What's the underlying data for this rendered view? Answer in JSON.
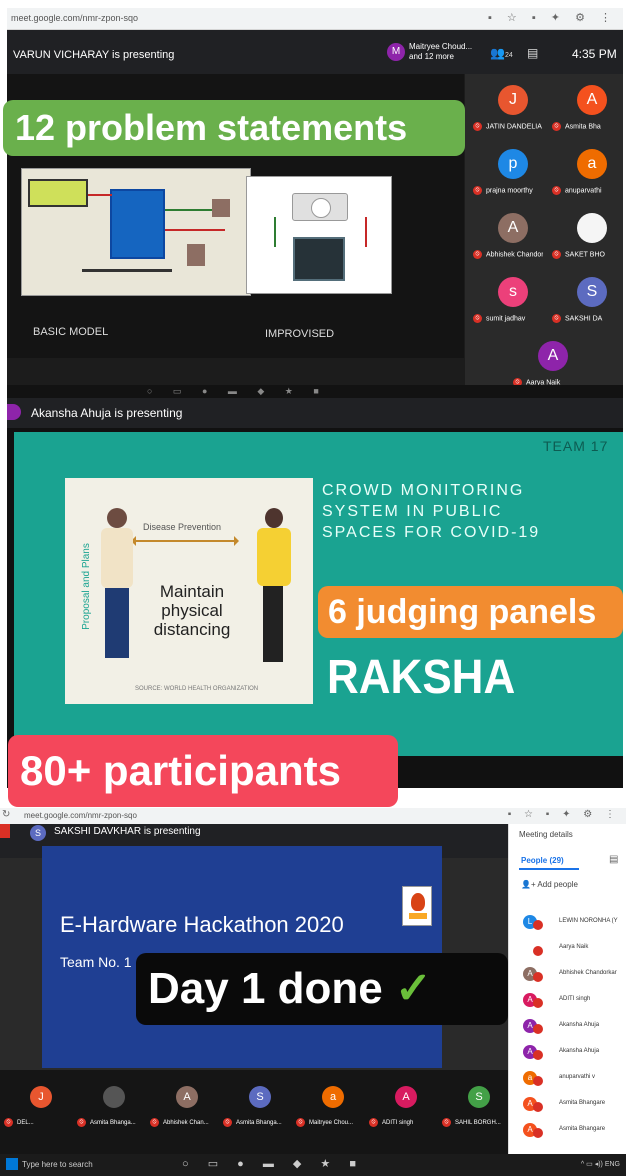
{
  "panel1": {
    "url": "meet.google.com/nmr-zpon-sqo",
    "presenting": "VARUN VICHARAY is presenting",
    "host_initial": "M",
    "host_name": "Maitryee Choud... and 12 more",
    "people_count": "24",
    "time": "4:35 PM",
    "banner": "12 problem statements",
    "caption_basic": "BASIC MODEL",
    "caption_improvised": "IMPROVISED",
    "tiles": [
      {
        "initial": "J",
        "name": "JATIN DANDELIA",
        "color": "#e8562f"
      },
      {
        "initial": "A",
        "name": "Asmita Bha",
        "color": "#f4511e"
      },
      {
        "initial": "p",
        "name": "prajna moorthy",
        "color": "#1e88e5"
      },
      {
        "initial": "a",
        "name": "anuparvathi",
        "color": "#ef6c00"
      },
      {
        "initial": "A",
        "name": "Abhishek Chandorkar",
        "color": "#8d6e63"
      },
      {
        "initial": "",
        "name": "SAKET BHO",
        "color": "#f5f5f5"
      },
      {
        "initial": "s",
        "name": "sumit jadhav",
        "color": "#ec407a"
      },
      {
        "initial": "S",
        "name": "SAKSHI DA",
        "color": "#5c6bc0"
      },
      {
        "initial": "A",
        "name": "Aarya Naik",
        "color": "#8e24aa"
      }
    ]
  },
  "panel2": {
    "presenting": "Akansha Ahuja is presenting",
    "team": "TEAM 17",
    "title_lines": [
      "CROWD MONITORING",
      "SYSTEM IN PUBLIC",
      "SPACES FOR COVID-19"
    ],
    "poster_vertical": "Proposal and Plans",
    "poster_top": "Disease Prevention",
    "poster_main": "Maintain physical distancing",
    "poster_source": "SOURCE: WORLD HEALTH ORGANIZATION",
    "banner": "6 judging panels",
    "project": "RAKSHA",
    "participants_banner": "80+ participants"
  },
  "panel3": {
    "url": "meet.google.com/nmr-zpon-sqo",
    "presenter_initial": "S",
    "presenting": "SAKSHI DAVKHAR is presenting",
    "hackathon": "E-Hardware Hackathon 2020",
    "team_no": "Team No. 1",
    "banner": "Day 1 done",
    "check": "✓",
    "meeting_details": "Meeting details",
    "people_tab": "People (29)",
    "add_people": "Add people",
    "people": [
      {
        "initial": "L",
        "name": "LEWIN NORONHA (Y",
        "color": "#1e88e5"
      },
      {
        "initial": "",
        "name": "Aarya Naik",
        "color": "#ffffff"
      },
      {
        "initial": "A",
        "name": "Abhishek Chandorkar",
        "color": "#8d6e63"
      },
      {
        "initial": "A",
        "name": "ADITI singh",
        "color": "#d81b60"
      },
      {
        "initial": "A",
        "name": "Akansha Ahuja",
        "color": "#8e24aa"
      },
      {
        "initial": "A",
        "name": "Akansha Ahuja",
        "color": "#8e24aa"
      },
      {
        "initial": "a",
        "name": "anuparvathi v",
        "color": "#ef6c00"
      },
      {
        "initial": "A",
        "name": "Asmita Bhangare",
        "color": "#f4511e"
      },
      {
        "initial": "A",
        "name": "Asmita Bhangare",
        "color": "#f4511e"
      }
    ],
    "bottom_tiles": [
      {
        "initial": "J",
        "name": "DEL...",
        "color": "#e8562f"
      },
      {
        "initial": "",
        "name": "Asmita Bhanga...",
        "color": "#555555"
      },
      {
        "initial": "A",
        "name": "Abhishek Chan...",
        "color": "#8d6e63"
      },
      {
        "initial": "S",
        "name": "Asmita Bhanga...",
        "color": "#5c6bc0"
      },
      {
        "initial": "a",
        "name": "Maitryee Chou...",
        "color": "#ef6c00"
      },
      {
        "initial": "A",
        "name": "ADITI singh",
        "color": "#d81b60"
      },
      {
        "initial": "S",
        "name": "SAHIL BORGH...",
        "color": "#43a047"
      }
    ],
    "search_placeholder": "Type here to search",
    "tray": "ENG"
  }
}
